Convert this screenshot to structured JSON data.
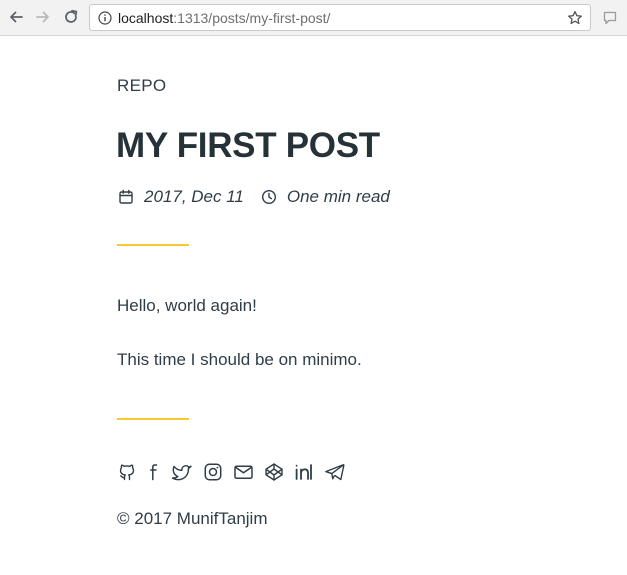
{
  "browser": {
    "url_host": "localhost",
    "url_path": ":1313/posts/my-first-post/",
    "back_icon": "arrow-left-icon",
    "forward_icon": "arrow-right-icon",
    "reload_icon": "reload-icon",
    "info_icon": "info-icon",
    "bookmark_icon": "star-icon",
    "extension_icon": "chat-bubble-icon"
  },
  "site": {
    "title": "REPO"
  },
  "post": {
    "title": "MY FIRST POST",
    "date": "2017, Dec 11",
    "read_time": "One min read",
    "paragraphs": [
      "Hello, world again!",
      "This time I should be on minimo."
    ]
  },
  "footer": {
    "social_icons": [
      "github-icon",
      "facebook-icon",
      "twitter-icon",
      "instagram-icon",
      "email-icon",
      "codepen-icon",
      "linkedin-icon",
      "telegram-icon"
    ],
    "copyright": "© 2017 MunifTanjim"
  },
  "colors": {
    "text": "#2f3d47",
    "accent": "#f9c72f",
    "toolbar": "#f2f2f2"
  }
}
